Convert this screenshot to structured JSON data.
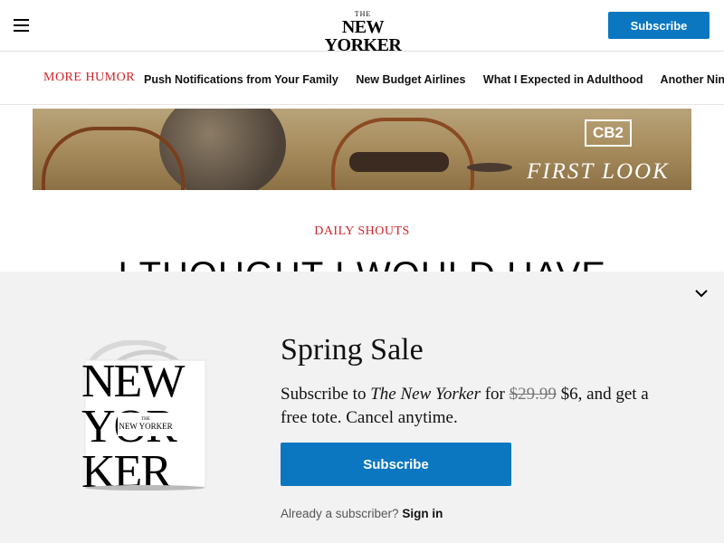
{
  "header": {
    "logo_the": "THE",
    "logo_name": "NEW YORKER",
    "subscribe_label": "Subscribe"
  },
  "subnav": {
    "more_label": "MORE HUMOR",
    "links": [
      "Push Notifications from Your Family",
      "New Budget Airlines",
      "What I Expected in Adulthood",
      "Another Nineties W"
    ]
  },
  "ad": {
    "brand": "CB2",
    "tagline": "FIRST LOOK"
  },
  "article": {
    "kicker": "DAILY SHOUTS",
    "headline": "I THOUGHT I WOULD HAVE"
  },
  "modal": {
    "title": "Spring Sale",
    "text_prefix": "Subscribe to",
    "publication": "The New Yorker",
    "text_for": "for",
    "old_price": "$29.99",
    "new_price": "$6, and get a free tote. Cancel anytime.",
    "subscribe_label": "Subscribe",
    "signin_prompt": "Already a subscriber?",
    "signin_link": "Sign in",
    "tote_logo": "NEW YORKER",
    "tote_the": "THE"
  },
  "colors": {
    "accent_blue": "#0b77c1",
    "kicker_red": "#d2232a",
    "modal_bg": "#f2f2f2"
  }
}
